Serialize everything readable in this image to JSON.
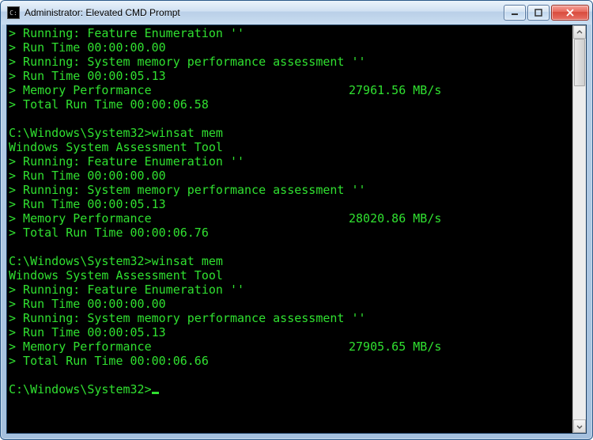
{
  "window": {
    "title": "Administrator: Elevated CMD Prompt",
    "icon_label": "cmd-icon"
  },
  "colors": {
    "terminal_fg": "#30e030",
    "terminal_bg": "#000000"
  },
  "prompt_path": "C:\\Windows\\System32>",
  "command": "winsat mem",
  "tool_header": "Windows System Assessment Tool",
  "runs": [
    {
      "feature_line": "> Running: Feature Enumeration ''",
      "feature_time": "> Run Time 00:00:00.00",
      "mem_line": "> Running: System memory performance assessment ''",
      "mem_time": "> Run Time 00:00:05.13",
      "perf_label": "> Memory Performance",
      "perf_value": "27961.56 MB/s",
      "total": "> Total Run Time 00:00:06.58"
    },
    {
      "feature_line": "> Running: Feature Enumeration ''",
      "feature_time": "> Run Time 00:00:00.00",
      "mem_line": "> Running: System memory performance assessment ''",
      "mem_time": "> Run Time 00:00:05.13",
      "perf_label": "> Memory Performance",
      "perf_value": "28020.86 MB/s",
      "total": "> Total Run Time 00:00:06.76"
    },
    {
      "feature_line": "> Running: Feature Enumeration ''",
      "feature_time": "> Run Time 00:00:00.00",
      "mem_line": "> Running: System memory performance assessment ''",
      "mem_time": "> Run Time 00:00:05.13",
      "perf_label": "> Memory Performance",
      "perf_value": "27905.65 MB/s",
      "total": "> Total Run Time 00:00:06.66"
    }
  ]
}
